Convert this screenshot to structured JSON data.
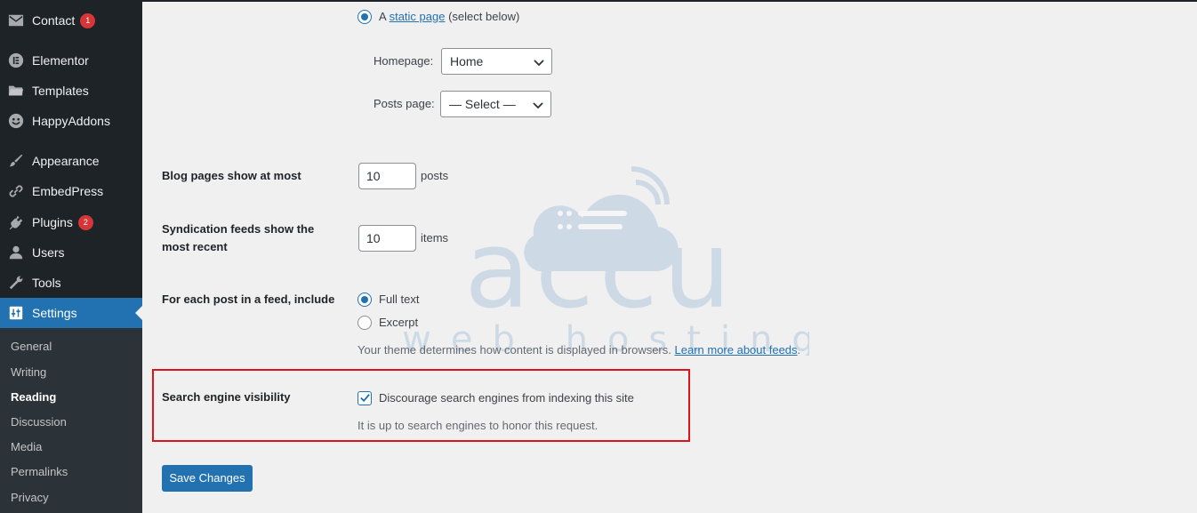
{
  "sidebar": {
    "items": [
      {
        "label": "Contact",
        "icon": "mail-icon",
        "badge": "1"
      },
      {
        "label": "Elementor",
        "icon": "elementor-icon"
      },
      {
        "label": "Templates",
        "icon": "folder-icon"
      },
      {
        "label": "HappyAddons",
        "icon": "happy-face-icon"
      },
      {
        "label": "Appearance",
        "icon": "paintbrush-icon"
      },
      {
        "label": "EmbedPress",
        "icon": "embed-link-icon"
      },
      {
        "label": "Plugins",
        "icon": "plug-icon",
        "badge": "2"
      },
      {
        "label": "Users",
        "icon": "user-icon"
      },
      {
        "label": "Tools",
        "icon": "wrench-icon"
      },
      {
        "label": "Settings",
        "icon": "settings-sliders-icon"
      }
    ],
    "submenu": [
      {
        "label": "General"
      },
      {
        "label": "Writing"
      },
      {
        "label": "Reading"
      },
      {
        "label": "Discussion"
      },
      {
        "label": "Media"
      },
      {
        "label": "Permalinks"
      },
      {
        "label": "Privacy"
      }
    ]
  },
  "homepage_display": {
    "static_prefix": "A",
    "static_link": "static page",
    "static_suffix": "(select below)",
    "homepage_label": "Homepage:",
    "homepage_value": "Home",
    "posts_page_label": "Posts page:",
    "posts_page_value": "— Select —"
  },
  "blog_pages": {
    "label": "Blog pages show at most",
    "value": "10",
    "unit": "posts"
  },
  "syndication": {
    "label_line1": "Syndication feeds show the",
    "label_line2": "most recent",
    "value": "10",
    "unit": "items"
  },
  "feed_include": {
    "label": "For each post in a feed, include",
    "option_full": "Full text",
    "option_excerpt": "Excerpt",
    "note": "Your theme determines how content is displayed in browsers.",
    "note_link": "Learn more about feeds",
    "note_end": "."
  },
  "search_visibility": {
    "label": "Search engine visibility",
    "checkbox_label": "Discourage search engines from indexing this site",
    "note": "It is up to search engines to honor this request."
  },
  "save_button": "Save Changes",
  "watermark": {
    "word": "accu",
    "sub": "web hosting"
  },
  "colors": {
    "sidebar_bg": "#1d2327",
    "accent": "#2271b1",
    "highlight_border": "#e0131b",
    "badge": "#d63638"
  }
}
